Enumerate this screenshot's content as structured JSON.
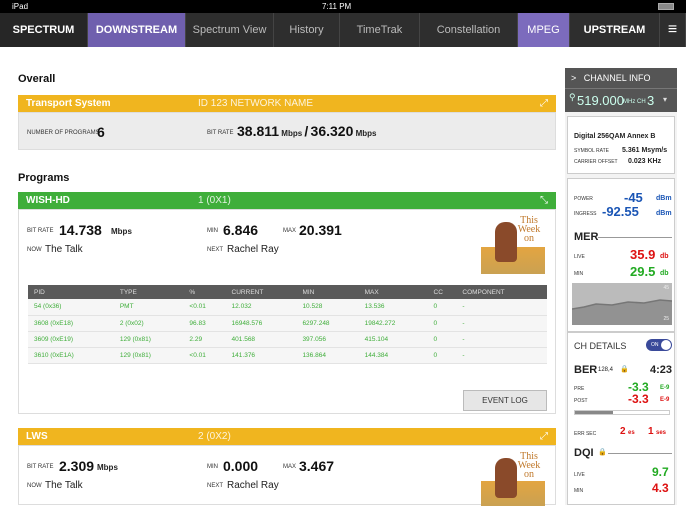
{
  "status": {
    "device": "iPad",
    "time": "7:11 PM"
  },
  "nav": {
    "spectrum": "SPECTRUM",
    "downstream": "DOWNSTREAM",
    "spectrum_view": "Spectrum View",
    "history": "History",
    "timetrak": "TimeTrak",
    "constellation": "Constellation",
    "mpeg": "MPEG",
    "upstream": "UPSTREAM",
    "menu": "≡"
  },
  "overall": {
    "heading": "Overall",
    "bar_title": "Transport System",
    "bar_id": "ID 123   NETWORK NAME",
    "num_programs_label": "NUMBER OF PROGRAMS",
    "num_programs": "6",
    "bitrate_label": "BIT RATE",
    "bitrate_a": "38.811",
    "unit_a": "Mbps",
    "sep": "/",
    "bitrate_b": "36.320",
    "unit_b": "Mbps"
  },
  "programs": {
    "heading": "Programs",
    "p1": {
      "name": "WISH-HD",
      "id": "1 (0X1)",
      "bitrate_label": "BIT RATE",
      "bitrate": "14.738",
      "unit": "Mbps",
      "min_label": "MIN",
      "min": "6.846",
      "max_label": "MAX",
      "max": "20.391",
      "now_label": "NOW",
      "now": "The Talk",
      "next_label": "NEXT",
      "next": "Rachel Ray",
      "thumb_text": "This Week on"
    },
    "table": {
      "headers": [
        "PID",
        "TYPE",
        "%",
        "CURRENT",
        "MIN",
        "MAX",
        "CC",
        "COMPONENT"
      ],
      "rows": [
        [
          "54 (0x36)",
          "PMT",
          "<0.01",
          "12.032",
          "10.528",
          "13.536",
          "0",
          "-"
        ],
        [
          "3608 (0xE18)",
          "2 (0x02)",
          "96.83",
          "16948.576",
          "6297.248",
          "19842.272",
          "0",
          "-"
        ],
        [
          "3609 (0xE19)",
          "129 (0x81)",
          "2.29",
          "401.568",
          "397.056",
          "415.104",
          "0",
          "-"
        ],
        [
          "3610 (0xE1A)",
          "129 (0x81)",
          "<0.01",
          "141.376",
          "136.864",
          "144.384",
          "0",
          "-"
        ]
      ]
    },
    "event_log": "EVENT LOG",
    "p2": {
      "name": "LWS",
      "id": "2 (0X2)",
      "bitrate_label": "BIT RATE",
      "bitrate": "2.309",
      "unit": "Mbps",
      "min_label": "MIN",
      "min": "0.000",
      "max_label": "MAX",
      "max": "3.467",
      "now_label": "NOW",
      "now": "The Talk",
      "next_label": "NEXT",
      "next": "Rachel Ray",
      "thumb_text": "This Week on"
    }
  },
  "side": {
    "header": "CHANNEL INFO",
    "chev": ">",
    "freq": "519.000",
    "freq_unit": "MHz",
    "ch_label": "CH",
    "ch": "3",
    "mod": "Digital 256QAM Annex B",
    "sym_label": "SYMBOL RATE",
    "sym": "5.361 Msym/s",
    "co_label": "CARRIER OFFSET",
    "co": "0.023 KHz",
    "power_label": "POWER",
    "power": "-45",
    "power_unit": "dBm",
    "ingress_label": "INGRESS",
    "ingress": "-92.55",
    "ingress_unit": "dBm",
    "mer_label": "MER",
    "mer_live_label": "LIVE",
    "mer_live": "35.9",
    "mer_min_label": "MIN",
    "mer_min": "29.5",
    "mer_unit": "db",
    "graph_top": "45",
    "graph_bot": "25",
    "chd_label": "CH DETAILS",
    "toggle": "ON",
    "ber_label": "BER",
    "ber_sub": "128,4",
    "ber_time": "4:23",
    "pre_label": "PRE",
    "pre": "-3.3",
    "pre_exp": "E-9",
    "post_label": "POST",
    "post": "-3.3",
    "post_exp": "E-9",
    "errsec_label": "ERR SEC",
    "errsec": "2",
    "errsec_unit": "es",
    "ses": "1",
    "ses_unit": "ses",
    "dqi_label": "DQI",
    "dqi_live_label": "LIVE",
    "dqi_live": "9.7",
    "dqi_min_label": "MIN",
    "dqi_min": "4.3"
  }
}
